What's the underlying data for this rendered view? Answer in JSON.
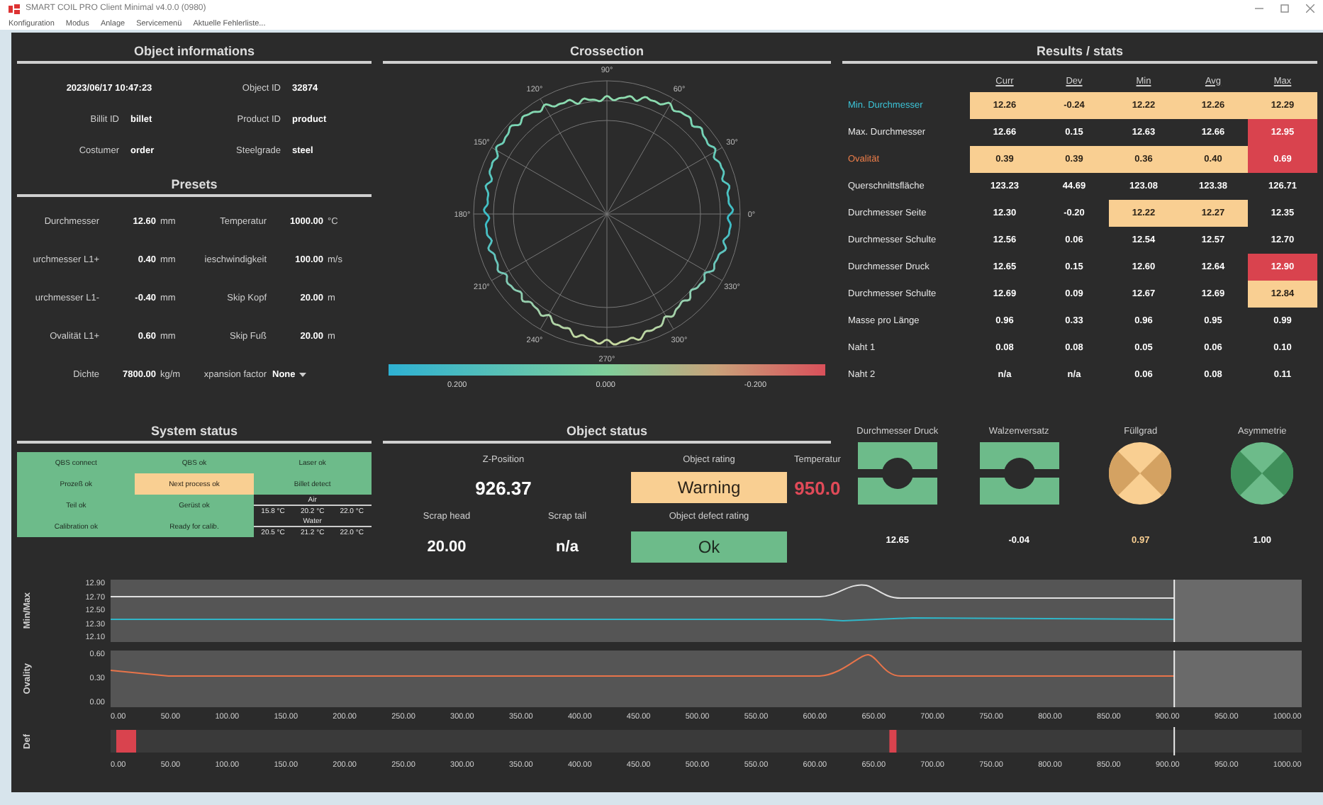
{
  "window": {
    "title": "SMART COIL PRO Client Minimal v4.0.0 (0980)",
    "menu": [
      "Konfiguration",
      "Modus",
      "Anlage",
      "Servicemenü",
      "Aktuelle Fehlerliste..."
    ]
  },
  "object_informations": {
    "title": "Object informations",
    "timestamp": "2023/06/17 10:47:23",
    "fields": [
      {
        "label": "Object ID",
        "value": "32874"
      },
      {
        "label": "Billit ID",
        "value": "billet"
      },
      {
        "label": "Product ID",
        "value": "product"
      },
      {
        "label": "Costumer",
        "value": "order"
      },
      {
        "label": "Steelgrade",
        "value": "steel"
      }
    ]
  },
  "presets": {
    "title": "Presets",
    "fields": [
      {
        "kind": "number",
        "label": "Durchmesser",
        "value": "12.60",
        "unit": "mm"
      },
      {
        "kind": "number",
        "label": "Temperatur",
        "value": "1000.00",
        "unit": "°C"
      },
      {
        "kind": "number",
        "label": "urchmesser L1+",
        "value": "0.40",
        "unit": "mm"
      },
      {
        "kind": "number",
        "label": "ieschwindigkeit",
        "value": "100.00",
        "unit": "m/s"
      },
      {
        "kind": "number",
        "label": "urchmesser L1-",
        "value": "-0.40",
        "unit": "mm"
      },
      {
        "kind": "number",
        "label": "Skip Kopf",
        "value": "20.00",
        "unit": "m"
      },
      {
        "kind": "number",
        "label": "Ovalität L1+",
        "value": "0.60",
        "unit": "mm"
      },
      {
        "kind": "number",
        "label": "Skip Fuß",
        "value": "20.00",
        "unit": "m"
      },
      {
        "kind": "number",
        "label": "Dichte",
        "value": "7800.00",
        "unit": "kg/m"
      },
      {
        "kind": "dropdown",
        "label": "xpansion factor",
        "value": "None"
      }
    ]
  },
  "crossection": {
    "title": "Crossection",
    "angle_labels": [
      "0°",
      "30°",
      "60°",
      "90°",
      "120°",
      "150°",
      "180°",
      "210°",
      "240°",
      "270°",
      "300°",
      "330°"
    ],
    "colorbar_labels": [
      "0.200",
      "0.000",
      "-0.200"
    ]
  },
  "results": {
    "title": "Results / stats",
    "columns": [
      "Curr",
      "Dev",
      "Min",
      "Avg",
      "Max"
    ],
    "rows": [
      {
        "label": "Min. Durchmesser",
        "color": "#3cc4d8",
        "cells": [
          {
            "value": "12.26",
            "warning": true,
            "alarm": false
          },
          {
            "value": "-0.24",
            "warning": true,
            "alarm": false
          },
          {
            "value": "12.22",
            "warning": true,
            "alarm": false
          },
          {
            "value": "12.26",
            "warning": true,
            "alarm": false
          },
          {
            "value": "12.29",
            "warning": true,
            "alarm": false
          }
        ]
      },
      {
        "label": "Max. Durchmesser",
        "color": "#e6e6e6",
        "cells": [
          {
            "value": "12.66",
            "warning": false,
            "alarm": false
          },
          {
            "value": "0.15",
            "warning": false,
            "alarm": false
          },
          {
            "value": "12.63",
            "warning": false,
            "alarm": false
          },
          {
            "value": "12.66",
            "warning": false,
            "alarm": false
          },
          {
            "value": "12.95",
            "warning": false,
            "alarm": true
          }
        ]
      },
      {
        "label": "Ovalität",
        "color": "#f07f4a",
        "cells": [
          {
            "value": "0.39",
            "warning": true,
            "alarm": false
          },
          {
            "value": "0.39",
            "warning": true,
            "alarm": false
          },
          {
            "value": "0.36",
            "warning": true,
            "alarm": false
          },
          {
            "value": "0.40",
            "warning": true,
            "alarm": false
          },
          {
            "value": "0.69",
            "warning": false,
            "alarm": true
          }
        ]
      },
      {
        "label": "Querschnittsfläche",
        "color": "#e6e6e6",
        "cells": [
          {
            "value": "123.23",
            "warning": false,
            "alarm": false
          },
          {
            "value": "44.69",
            "warning": false,
            "alarm": false
          },
          {
            "value": "123.08",
            "warning": false,
            "alarm": false
          },
          {
            "value": "123.38",
            "warning": false,
            "alarm": false
          },
          {
            "value": "126.71",
            "warning": false,
            "alarm": false
          }
        ]
      },
      {
        "label": "Durchmesser Seite",
        "color": "#e6e6e6",
        "cells": [
          {
            "value": "12.30",
            "warning": false,
            "alarm": false
          },
          {
            "value": "-0.20",
            "warning": false,
            "alarm": false
          },
          {
            "value": "12.22",
            "warning": true,
            "alarm": false
          },
          {
            "value": "12.27",
            "warning": true,
            "alarm": false
          },
          {
            "value": "12.35",
            "warning": false,
            "alarm": false
          }
        ]
      },
      {
        "label": "Durchmesser Schulte",
        "color": "#e6e6e6",
        "cells": [
          {
            "value": "12.56",
            "warning": false,
            "alarm": false
          },
          {
            "value": "0.06",
            "warning": false,
            "alarm": false
          },
          {
            "value": "12.54",
            "warning": false,
            "alarm": false
          },
          {
            "value": "12.57",
            "warning": false,
            "alarm": false
          },
          {
            "value": "12.70",
            "warning": false,
            "alarm": false
          }
        ]
      },
      {
        "label": "Durchmesser Druck",
        "color": "#e6e6e6",
        "cells": [
          {
            "value": "12.65",
            "warning": false,
            "alarm": false
          },
          {
            "value": "0.15",
            "warning": false,
            "alarm": false
          },
          {
            "value": "12.60",
            "warning": false,
            "alarm": false
          },
          {
            "value": "12.64",
            "warning": false,
            "alarm": false
          },
          {
            "value": "12.90",
            "warning": false,
            "alarm": true
          }
        ]
      },
      {
        "label": "Durchmesser Schulte",
        "color": "#e6e6e6",
        "cells": [
          {
            "value": "12.69",
            "warning": false,
            "alarm": false
          },
          {
            "value": "0.09",
            "warning": false,
            "alarm": false
          },
          {
            "value": "12.67",
            "warning": false,
            "alarm": false
          },
          {
            "value": "12.69",
            "warning": false,
            "alarm": false
          },
          {
            "value": "12.84",
            "warning": true,
            "alarm": false
          }
        ]
      },
      {
        "label": "Masse pro Länge",
        "color": "#e6e6e6",
        "cells": [
          {
            "value": "0.96",
            "warning": false,
            "alarm": false
          },
          {
            "value": "0.33",
            "warning": false,
            "alarm": false
          },
          {
            "value": "0.96",
            "warning": false,
            "alarm": false
          },
          {
            "value": "0.95",
            "warning": false,
            "alarm": false
          },
          {
            "value": "0.99",
            "warning": false,
            "alarm": false
          }
        ]
      },
      {
        "label": "Naht 1",
        "color": "#e6e6e6",
        "cells": [
          {
            "value": "0.08",
            "warning": false,
            "alarm": false
          },
          {
            "value": "0.08",
            "warning": false,
            "alarm": false
          },
          {
            "value": "0.05",
            "warning": false,
            "alarm": false
          },
          {
            "value": "0.06",
            "warning": false,
            "alarm": false
          },
          {
            "value": "0.10",
            "warning": false,
            "alarm": false
          }
        ]
      },
      {
        "label": "Naht 2",
        "color": "#e6e6e6",
        "cells": [
          {
            "value": "n/a",
            "warning": false,
            "alarm": false
          },
          {
            "value": "n/a",
            "warning": false,
            "alarm": false
          },
          {
            "value": "0.06",
            "warning": false,
            "alarm": false
          },
          {
            "value": "0.08",
            "warning": false,
            "alarm": false
          },
          {
            "value": "0.11",
            "warning": false,
            "alarm": false
          }
        ]
      }
    ]
  },
  "system_status": {
    "title": "System status",
    "indicators": [
      {
        "label": "QBS connect",
        "warning": false
      },
      {
        "label": "QBS ok",
        "warning": false
      },
      {
        "label": "Laser ok",
        "warning": false
      },
      {
        "label": "Prozeß ok",
        "warning": false
      },
      {
        "label": "Next process ok",
        "warning": true
      },
      {
        "label": "Billet detect",
        "warning": false
      },
      {
        "label": "Teil ok",
        "warning": false
      },
      {
        "label": "Gerüst ok",
        "warning": false
      },
      {
        "label": "Calibration ok",
        "warning": false
      },
      {
        "label": "Ready for calib.",
        "warning": false
      }
    ],
    "climate": [
      {
        "label": "Air",
        "readings": [
          "15.8 °C",
          "20.2 °C",
          "22.0 °C"
        ]
      },
      {
        "label": "Water",
        "readings": [
          "20.5 °C",
          "21.2 °C",
          "22.0 °C"
        ]
      }
    ]
  },
  "object_status": {
    "title": "Object status",
    "z_position": {
      "label": "Z-Position",
      "value": "926.37"
    },
    "scrap_head": {
      "label": "Scrap head",
      "value": "20.00"
    },
    "scrap_tail": {
      "label": "Scrap tail",
      "value": "n/a"
    },
    "object_rating": {
      "label": "Object rating",
      "value": "Warning",
      "warning": true
    },
    "object_defect_rating": {
      "label": "Object defect rating",
      "value": "Ok",
      "warning": false
    },
    "temperature": {
      "label": "Temperatur",
      "value": "950.0",
      "alarm": true
    }
  },
  "gauges": [
    {
      "kind": "split_square",
      "label": "Durchmesser Druck",
      "value": "12.65",
      "warning": false
    },
    {
      "kind": "split_square",
      "label": "Walzenversatz",
      "value": "-0.04",
      "warning": false
    },
    {
      "kind": "cross_circle",
      "label": "Füllgrad",
      "value": "0.97",
      "warning": true
    },
    {
      "kind": "cross_circle",
      "label": "Asymmetrie",
      "value": "1.00",
      "warning": false
    }
  ],
  "trend": {
    "minmax": {
      "label": "Min/Max",
      "yticks": [
        "12.90",
        "12.70",
        "12.50",
        "12.30",
        "12.10"
      ]
    },
    "ovality": {
      "label": "Ovality",
      "yticks": [
        "0.60",
        "0.30",
        "0.00"
      ],
      "x_axis_labels": [
        "0.00",
        "50.00",
        "100.00",
        "150.00",
        "200.00",
        "250.00",
        "300.00",
        "350.00",
        "400.00",
        "450.00",
        "500.00",
        "550.00",
        "600.00",
        "650.00",
        "700.00",
        "750.00",
        "800.00",
        "850.00",
        "900.00",
        "950.00",
        "1000.00"
      ]
    },
    "defects": {
      "label": "Def",
      "x_axis_labels": [
        "0.00",
        "50.00",
        "100.00",
        "150.00",
        "200.00",
        "250.00",
        "300.00",
        "350.00",
        "400.00",
        "450.00",
        "500.00",
        "550.00",
        "600.00",
        "650.00",
        "700.00",
        "750.00",
        "800.00",
        "850.00",
        "900.00",
        "950.00",
        "1000.00"
      ]
    }
  }
}
